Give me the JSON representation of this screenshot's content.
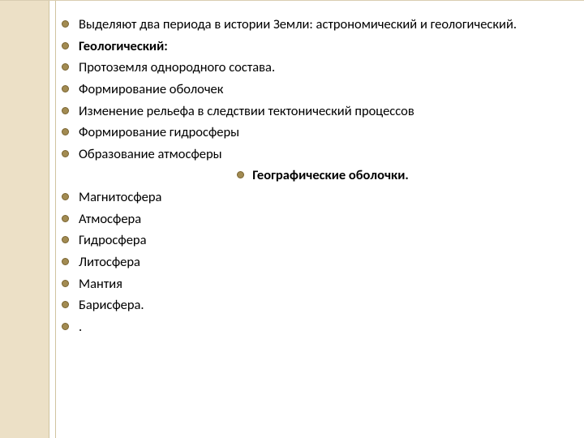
{
  "items": [
    {
      "text": "Выделяют два периода в истории Земли: астрономический и геологический.",
      "bold": false,
      "center": false,
      "justify": true
    },
    {
      "text": "Геологический:",
      "bold": true,
      "center": false,
      "justify": false
    },
    {
      "text": "Протоземля однородного состава.",
      "bold": false,
      "center": false,
      "justify": false
    },
    {
      "text": "Формирование оболочек",
      "bold": false,
      "center": false,
      "justify": false
    },
    {
      "text": "Изменение рельефа в следствии тектонический процессов",
      "bold": false,
      "center": false,
      "justify": false
    },
    {
      "text": "Формирование гидросферы",
      "bold": false,
      "center": false,
      "justify": false
    },
    {
      "text": "Образование атмосферы",
      "bold": false,
      "center": false,
      "justify": false
    },
    {
      "text": "Географические оболочки.",
      "bold": true,
      "center": true,
      "justify": false
    },
    {
      "text": "Магнитосфера",
      "bold": false,
      "center": false,
      "justify": false
    },
    {
      "text": "Атмосфера",
      "bold": false,
      "center": false,
      "justify": false
    },
    {
      "text": "Гидросфера",
      "bold": false,
      "center": false,
      "justify": false
    },
    {
      "text": "Литосфера",
      "bold": false,
      "center": false,
      "justify": false
    },
    {
      "text": "Мантия",
      "bold": false,
      "center": false,
      "justify": false
    },
    {
      "text": "Барисфера.",
      "bold": false,
      "center": false,
      "justify": false
    },
    {
      "text": ".",
      "bold": false,
      "center": false,
      "justify": false
    }
  ]
}
